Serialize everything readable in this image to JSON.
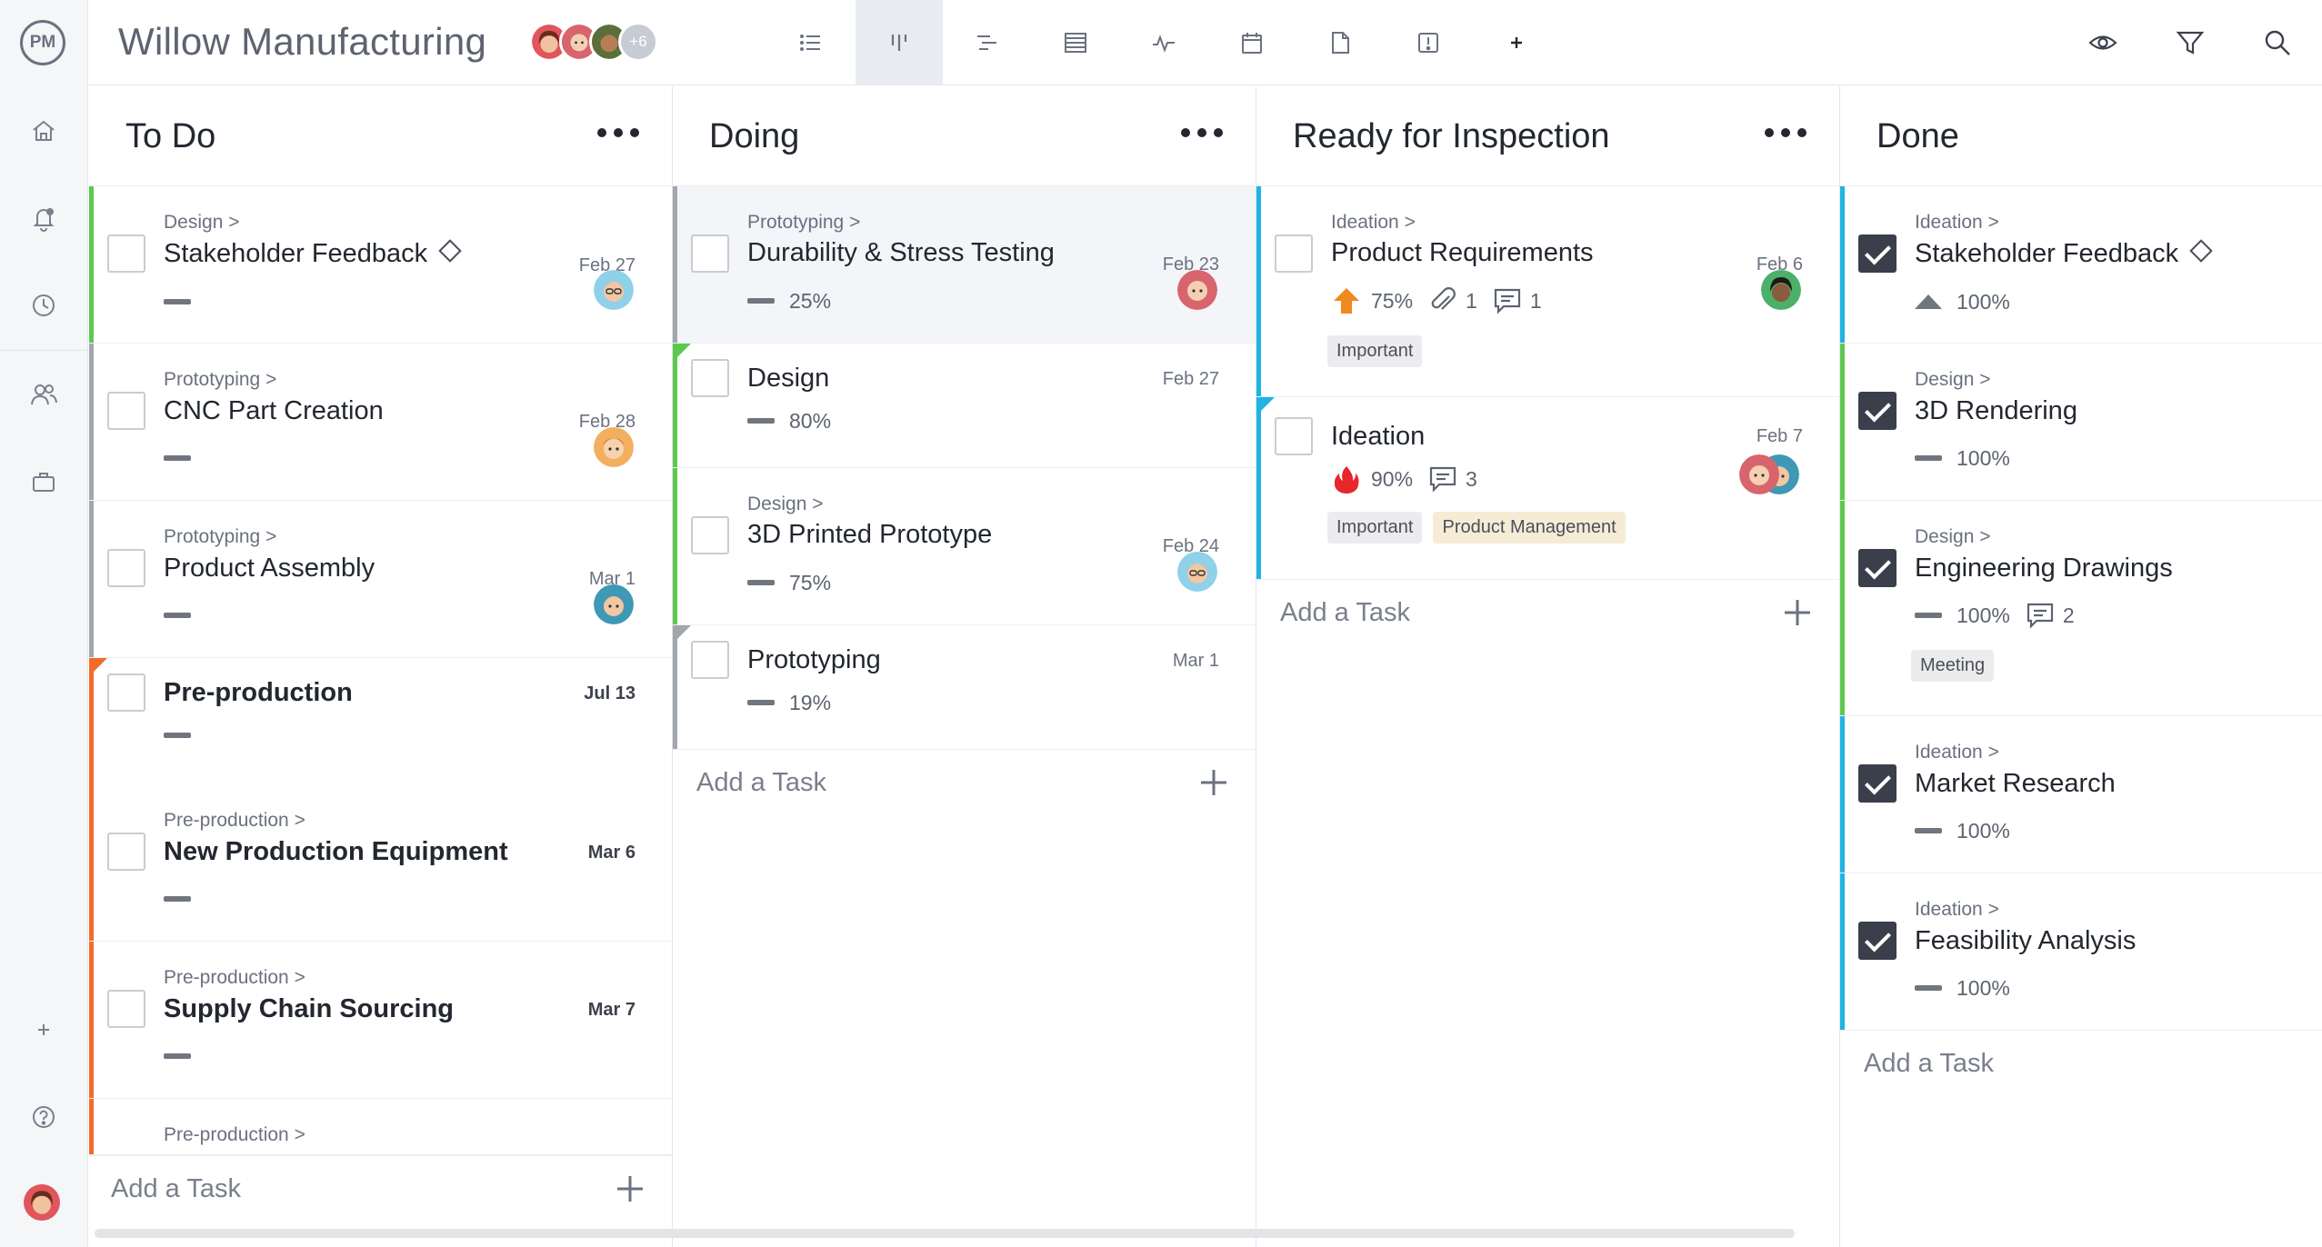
{
  "app": {
    "logo": "PM",
    "project_title": "Willow Manufacturing",
    "team_more": "+6",
    "views": [
      "list-view-icon",
      "board-view-icon",
      "gantt-view-icon",
      "sheet-view-icon",
      "dashboard-view-icon",
      "calendar-view-icon",
      "files-view-icon",
      "risk-view-icon",
      "add-view-icon"
    ],
    "active_view": "board-view-icon",
    "tools": [
      "eye-icon",
      "filter-icon",
      "search-icon"
    ]
  },
  "sidebar": {
    "items": [
      "home-icon",
      "notifications-icon",
      "timesheet-icon",
      "people-icon",
      "portfolio-icon"
    ],
    "bottom": [
      "add-icon",
      "help-icon",
      "user-avatar"
    ]
  },
  "colors": {
    "design": "#5cc94e",
    "prototyping": "#a2a6ad",
    "preproduction": "#f26b2a",
    "ideation": "#1fb3e6",
    "accent_bg": "#e8ebf0"
  },
  "board": {
    "add_task_label": "Add a Task",
    "columns": [
      {
        "title": "To Do",
        "cards": [
          {
            "crumb": "Design >",
            "name": "Stakeholder Feedback",
            "date": "Feb 27"
          },
          {
            "crumb": "Prototyping >",
            "name": "CNC Part Creation",
            "date": "Feb 28"
          },
          {
            "crumb": "Prototyping >",
            "name": "Product Assembly",
            "date": "Mar 1"
          },
          {
            "crumb": "",
            "name": "Pre-production",
            "date": "Jul 13"
          },
          {
            "crumb": "Pre-production >",
            "name": "New Production Equipment",
            "date": "Mar 6"
          },
          {
            "crumb": "Pre-production >",
            "name": "Supply Chain Sourcing",
            "date": "Mar 7"
          },
          {
            "crumb": "Pre-production >"
          }
        ]
      },
      {
        "title": "Doing",
        "cards": [
          {
            "crumb": "Prototyping >",
            "name": "Durability & Stress Testing",
            "date": "Feb 23",
            "progress": "25%"
          },
          {
            "crumb": "",
            "name": "Design",
            "date": "Feb 27",
            "progress": "80%"
          },
          {
            "crumb": "Design >",
            "name": "3D Printed Prototype",
            "date": "Feb 24",
            "progress": "75%"
          },
          {
            "crumb": "",
            "name": "Prototyping",
            "date": "Mar 1",
            "progress": "19%"
          }
        ]
      },
      {
        "title": "Ready for Inspection",
        "cards": [
          {
            "crumb": "Ideation >",
            "name": "Product Requirements",
            "date": "Feb 6",
            "progress": "75%",
            "attachments": "1",
            "comments": "1",
            "tags": [
              "Important"
            ]
          },
          {
            "crumb": "",
            "name": "Ideation",
            "date": "Feb 7",
            "progress": "90%",
            "comments": "3",
            "tags": [
              "Important",
              "Product Management"
            ]
          }
        ]
      },
      {
        "title": "Done",
        "cards": [
          {
            "crumb": "Ideation >",
            "name": "Stakeholder Feedback",
            "progress": "100%"
          },
          {
            "crumb": "Design >",
            "name": "3D Rendering",
            "progress": "100%"
          },
          {
            "crumb": "Design >",
            "name": "Engineering Drawings",
            "progress": "100%",
            "comments": "2",
            "tags": [
              "Meeting"
            ]
          },
          {
            "crumb": "Ideation >",
            "name": "Market Research",
            "progress": "100%"
          },
          {
            "crumb": "Ideation >",
            "name": "Feasibility Analysis",
            "progress": "100%"
          }
        ]
      }
    ]
  }
}
